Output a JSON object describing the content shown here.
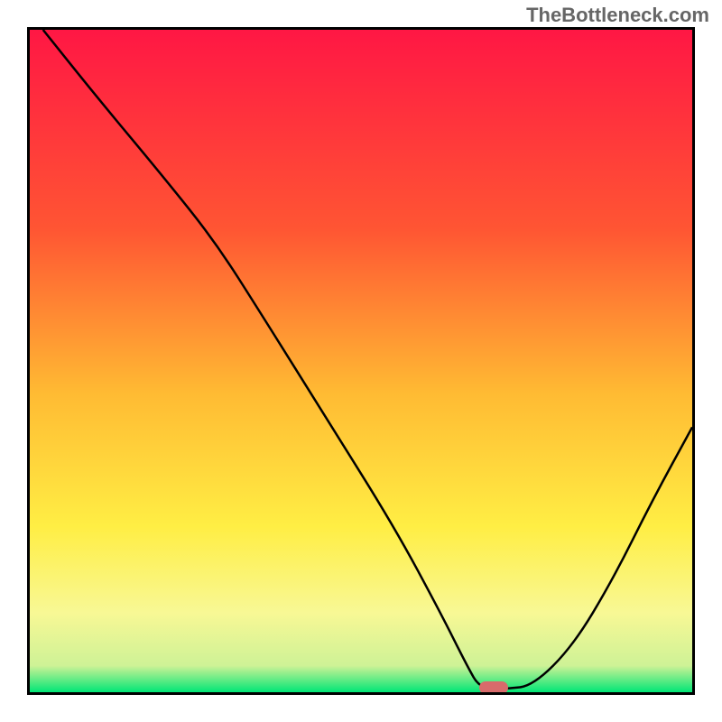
{
  "watermark": "TheBottleneck.com",
  "chart_data": {
    "type": "line",
    "title": "",
    "xlabel": "",
    "ylabel": "",
    "xlim": [
      0,
      100
    ],
    "ylim": [
      0,
      100
    ],
    "gradient": {
      "stops": [
        {
          "offset": 0,
          "color": "#ff1744"
        },
        {
          "offset": 30,
          "color": "#ff5533"
        },
        {
          "offset": 55,
          "color": "#ffbb33"
        },
        {
          "offset": 75,
          "color": "#ffee44"
        },
        {
          "offset": 88,
          "color": "#f8f895"
        },
        {
          "offset": 96,
          "color": "#cef296"
        },
        {
          "offset": 100,
          "color": "#00e676"
        }
      ]
    },
    "series": [
      {
        "name": "bottleneck-curve",
        "x": [
          2,
          10,
          20,
          28,
          35,
          45,
          55,
          62,
          66,
          68,
          72,
          76,
          82,
          88,
          94,
          100
        ],
        "y": [
          100,
          90,
          78,
          68,
          57,
          41,
          25,
          12,
          4,
          0.5,
          0.5,
          1,
          7,
          17,
          29,
          40
        ]
      }
    ],
    "marker": {
      "x": 70,
      "y": 0.5,
      "color": "#d86b6b"
    }
  }
}
